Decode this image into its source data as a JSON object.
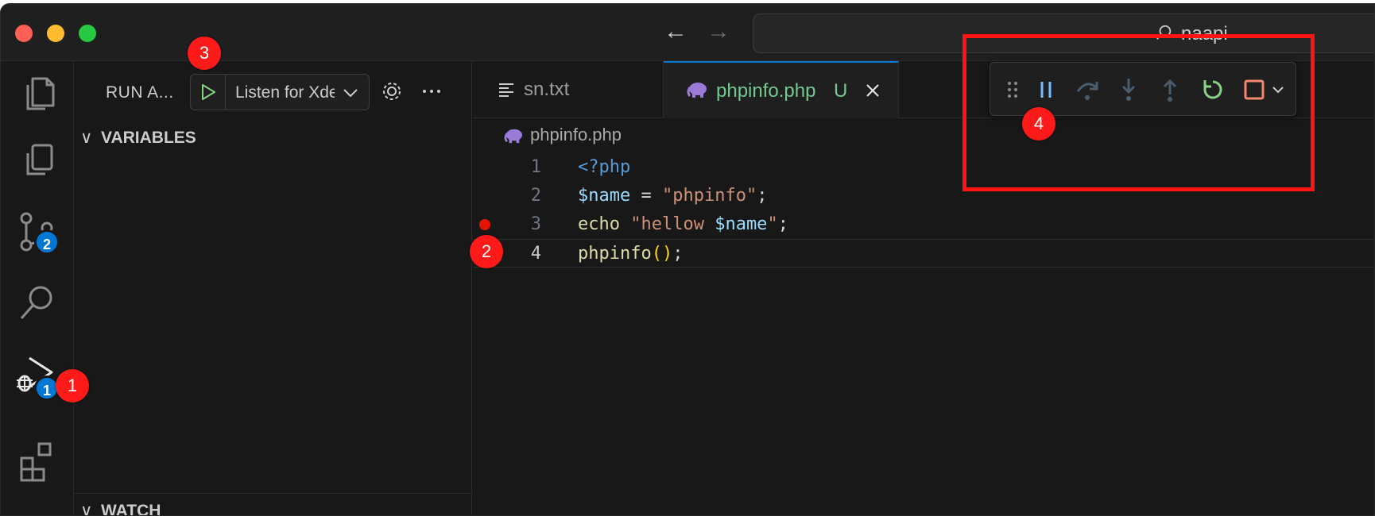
{
  "titlebar": {
    "search_text": "naapi"
  },
  "activity_bar": {
    "scm_badge": "2",
    "debug_badge": "1"
  },
  "sidebar": {
    "title": "RUN A...",
    "launch_config": "Listen for Xdebug",
    "variables_header": "VARIABLES",
    "watch_header": "WATCH"
  },
  "tabs": [
    {
      "label": "sn.txt"
    },
    {
      "label": "phpinfo.php",
      "status": "U"
    }
  ],
  "breadcrumb": {
    "file": "phpinfo.php"
  },
  "code": {
    "lines": [
      {
        "number": "1"
      },
      {
        "number": "2"
      },
      {
        "number": "3",
        "breakpoint": true
      },
      {
        "number": "4",
        "current": true
      }
    ]
  },
  "annotations": {
    "callout_1": "1",
    "callout_2": "2",
    "callout_3": "3",
    "callout_4": "4"
  },
  "icons": {
    "explorer": "files-icon",
    "debug": "run-debug-icon",
    "scm": "source-control-icon",
    "search": "search-icon",
    "extensions": "extensions-icon"
  },
  "colors": {
    "breakpoint": "#e51400",
    "badge": "#0078d4",
    "callout": "#ff1a1a",
    "continue": "#89d185",
    "stop": "#f48771"
  }
}
